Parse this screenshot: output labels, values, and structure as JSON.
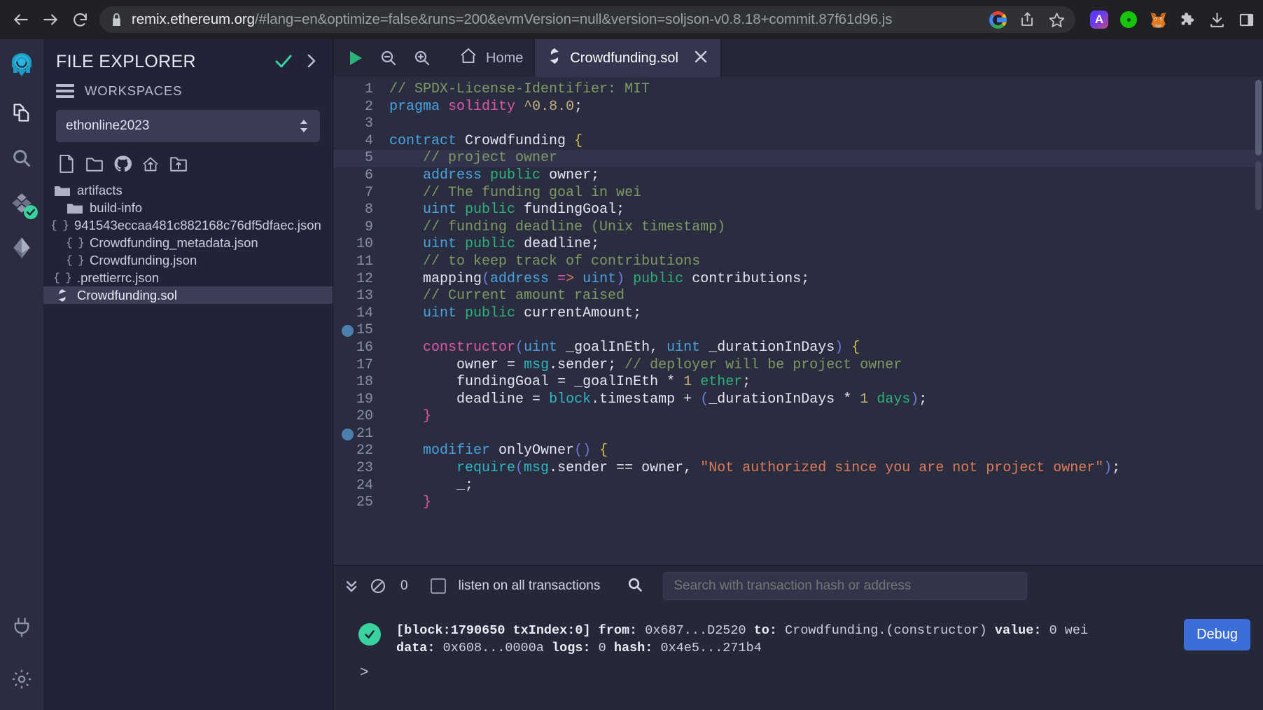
{
  "browser": {
    "back_icon": "arrow-left-icon",
    "forward_icon": "arrow-right-icon",
    "reload_icon": "reload-icon",
    "lock_icon": "lock-icon",
    "url_host": "remix.ethereum.org",
    "url_path": "/#lang=en&optimize=false&runs=200&evmVersion=null&version=soljson-v0.8.18+commit.87f61d96.js",
    "omni_icons": [
      "google-logo-icon",
      "share-icon",
      "bookmark-star-icon"
    ],
    "extension_icons": [
      "anchor-a-extension-icon",
      "green-record-extension-icon",
      "metamask-fox-icon",
      "extensions-puzzle-icon",
      "downloads-icon",
      "side-panel-icon"
    ]
  },
  "rail": {
    "logo": "remix-logo-icon",
    "items": [
      {
        "name": "sidebar-item-file-explorer",
        "icon": "files-icon",
        "active": true
      },
      {
        "name": "sidebar-item-search",
        "icon": "search-icon",
        "active": false
      },
      {
        "name": "sidebar-item-solidity-compiler",
        "icon": "solidity-compiler-icon",
        "active": false,
        "badge": "check"
      },
      {
        "name": "sidebar-item-deploy-run",
        "icon": "deploy-run-icon",
        "active": false
      }
    ],
    "bottom": [
      {
        "name": "sidebar-item-plugin-manager",
        "icon": "plug-icon"
      },
      {
        "name": "sidebar-item-settings",
        "icon": "gear-icon"
      }
    ]
  },
  "file_explorer": {
    "title": "FILE EXPLORER",
    "check_icon": "check-icon",
    "expand_icon": "chevron-right-icon",
    "hamburger_icon": "hamburger-icon",
    "workspaces_label": "WORKSPACES",
    "workspace_value": "ethonline2023",
    "workspace_caret_icon": "updown-caret-icon",
    "toolbar": [
      {
        "name": "create-new-file-button",
        "icon": "new-file-icon"
      },
      {
        "name": "create-new-folder-button",
        "icon": "new-folder-icon"
      },
      {
        "name": "clone-git-repository-button",
        "icon": "github-icon"
      },
      {
        "name": "publish-to-gist-button",
        "icon": "upload-home-icon"
      },
      {
        "name": "upload-folder-button",
        "icon": "folder-upload-icon"
      }
    ],
    "files": [
      {
        "label": "artifacts",
        "type": "folder",
        "indent": 0,
        "selected": false
      },
      {
        "label": "build-info",
        "type": "folder",
        "indent": 1,
        "selected": false
      },
      {
        "label": "941543eccaa481c882168c76df5dfaec.json",
        "type": "json",
        "indent": 2,
        "selected": false
      },
      {
        "label": "Crowdfunding_metadata.json",
        "type": "json",
        "indent": 1,
        "selected": false
      },
      {
        "label": "Crowdfunding.json",
        "type": "json",
        "indent": 1,
        "selected": false
      },
      {
        "label": ".prettierrc.json",
        "type": "json",
        "indent": 0,
        "selected": false
      },
      {
        "label": "Crowdfunding.sol",
        "type": "sol",
        "indent": 0,
        "selected": true
      }
    ]
  },
  "editor": {
    "toolbar": [
      {
        "name": "run-script-button",
        "icon": "play-icon"
      },
      {
        "name": "zoom-out-button",
        "icon": "zoom-out-icon"
      },
      {
        "name": "zoom-in-button",
        "icon": "zoom-in-icon"
      }
    ],
    "tabs": [
      {
        "label": "Home",
        "icon": "home-icon",
        "active": false,
        "closable": false
      },
      {
        "label": "Crowdfunding.sol",
        "icon": "solidity-icon",
        "active": true,
        "closable": true,
        "close_icon": "close-icon"
      }
    ],
    "highlighted_line": 5,
    "breakpoint_lines": [
      15,
      21
    ],
    "code_lines": [
      "// SPDX-License-Identifier: MIT",
      "pragma solidity ^0.8.0;",
      "",
      "contract Crowdfunding {",
      "    // project owner",
      "    address public owner;",
      "    // The funding goal in wei",
      "    uint public fundingGoal;",
      "    // funding deadline (Unix timestamp)",
      "    uint public deadline;",
      "    // to keep track of contributions",
      "    mapping(address => uint) public contributions;",
      "    // Current amount raised",
      "    uint public currentAmount;",
      "",
      "    constructor(uint _goalInEth, uint _durationInDays) {",
      "        owner = msg.sender; // deployer will be project owner",
      "        fundingGoal = _goalInEth * 1 ether;",
      "        deadline = block.timestamp + (_durationInDays * 1 days);",
      "    }",
      "",
      "    modifier onlyOwner() {",
      "        require(msg.sender == owner, \"Not authorized since you are not project owner\");",
      "        _;",
      "    }"
    ]
  },
  "terminal": {
    "collapse_icon": "double-chevron-down-icon",
    "clear_icon": "no-entry-icon",
    "pending_count": "0",
    "listen_label": "listen on all transactions",
    "listen_checked": false,
    "search_icon": "search-icon",
    "search_placeholder": "Search with transaction hash or address",
    "search_value": "",
    "status_icon": "success-check-icon",
    "tx_line1": "[block:1790650 txIndex:0] from: 0x687...D2520 to: Crowdfunding.(constructor) value: 0 wei",
    "tx_line2": "data: 0x608...0000a logs: 0 hash: 0x4e5...271b4",
    "tx_line1_parts": [
      {
        "t": "[block:1790650 txIndex:0]",
        "b": true
      },
      {
        "t": " from:",
        "b": true
      },
      {
        "t": " 0x687...D2520 ",
        "b": false
      },
      {
        "t": "to:",
        "b": true
      },
      {
        "t": " Crowdfunding.(constructor) ",
        "b": false
      },
      {
        "t": "value:",
        "b": true
      },
      {
        "t": " 0 wei",
        "b": false
      }
    ],
    "tx_line2_parts": [
      {
        "t": "data:",
        "b": true
      },
      {
        "t": " 0x608...0000a ",
        "b": false
      },
      {
        "t": "logs:",
        "b": true
      },
      {
        "t": " 0 ",
        "b": false
      },
      {
        "t": "hash:",
        "b": true
      },
      {
        "t": " 0x4e5...271b4",
        "b": false
      }
    ],
    "debug_label": "Debug",
    "prompt_symbol": ">"
  },
  "colors": {
    "accent_blue": "#3b6ed8",
    "success_green": "#3ad29f",
    "panel_bg": "#222336",
    "editor_bg": "#2a2c3f",
    "selected_row": "#3c3e57"
  }
}
